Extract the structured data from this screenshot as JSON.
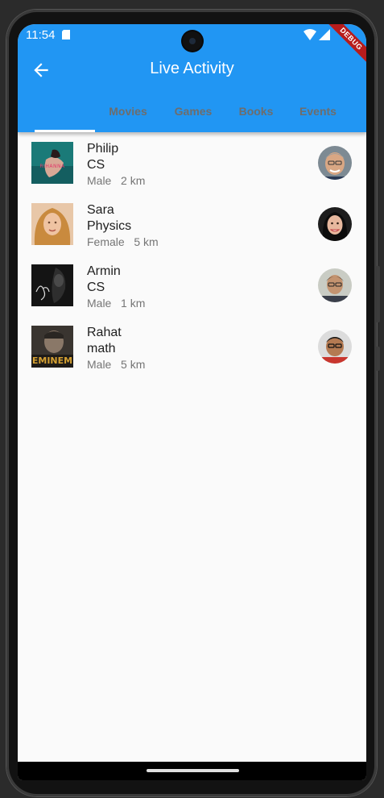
{
  "status_bar": {
    "time": "11:54"
  },
  "debug_banner": "DEBUG",
  "app_bar": {
    "title": "Live Activity"
  },
  "tabs": [
    {
      "label": "Movies"
    },
    {
      "label": "Games"
    },
    {
      "label": "Books"
    },
    {
      "label": "Events"
    }
  ],
  "people": [
    {
      "name": "Philip",
      "subject": "CS",
      "gender": "Male",
      "distance": "2 km"
    },
    {
      "name": "Sara",
      "subject": "Physics",
      "gender": "Female",
      "distance": "5 km"
    },
    {
      "name": "Armin",
      "subject": "CS",
      "gender": "Male",
      "distance": "1 km"
    },
    {
      "name": "Rahat",
      "subject": "math",
      "gender": "Male",
      "distance": "5 km"
    }
  ],
  "thumbnail_text": {
    "rihanna": "RIHANNA",
    "eminem": "EMINEM"
  },
  "colors": {
    "app_bar": "#2196f3",
    "tab_inactive": "#6d6d6d",
    "indicator": "#ffffff",
    "background": "#fafafa"
  }
}
